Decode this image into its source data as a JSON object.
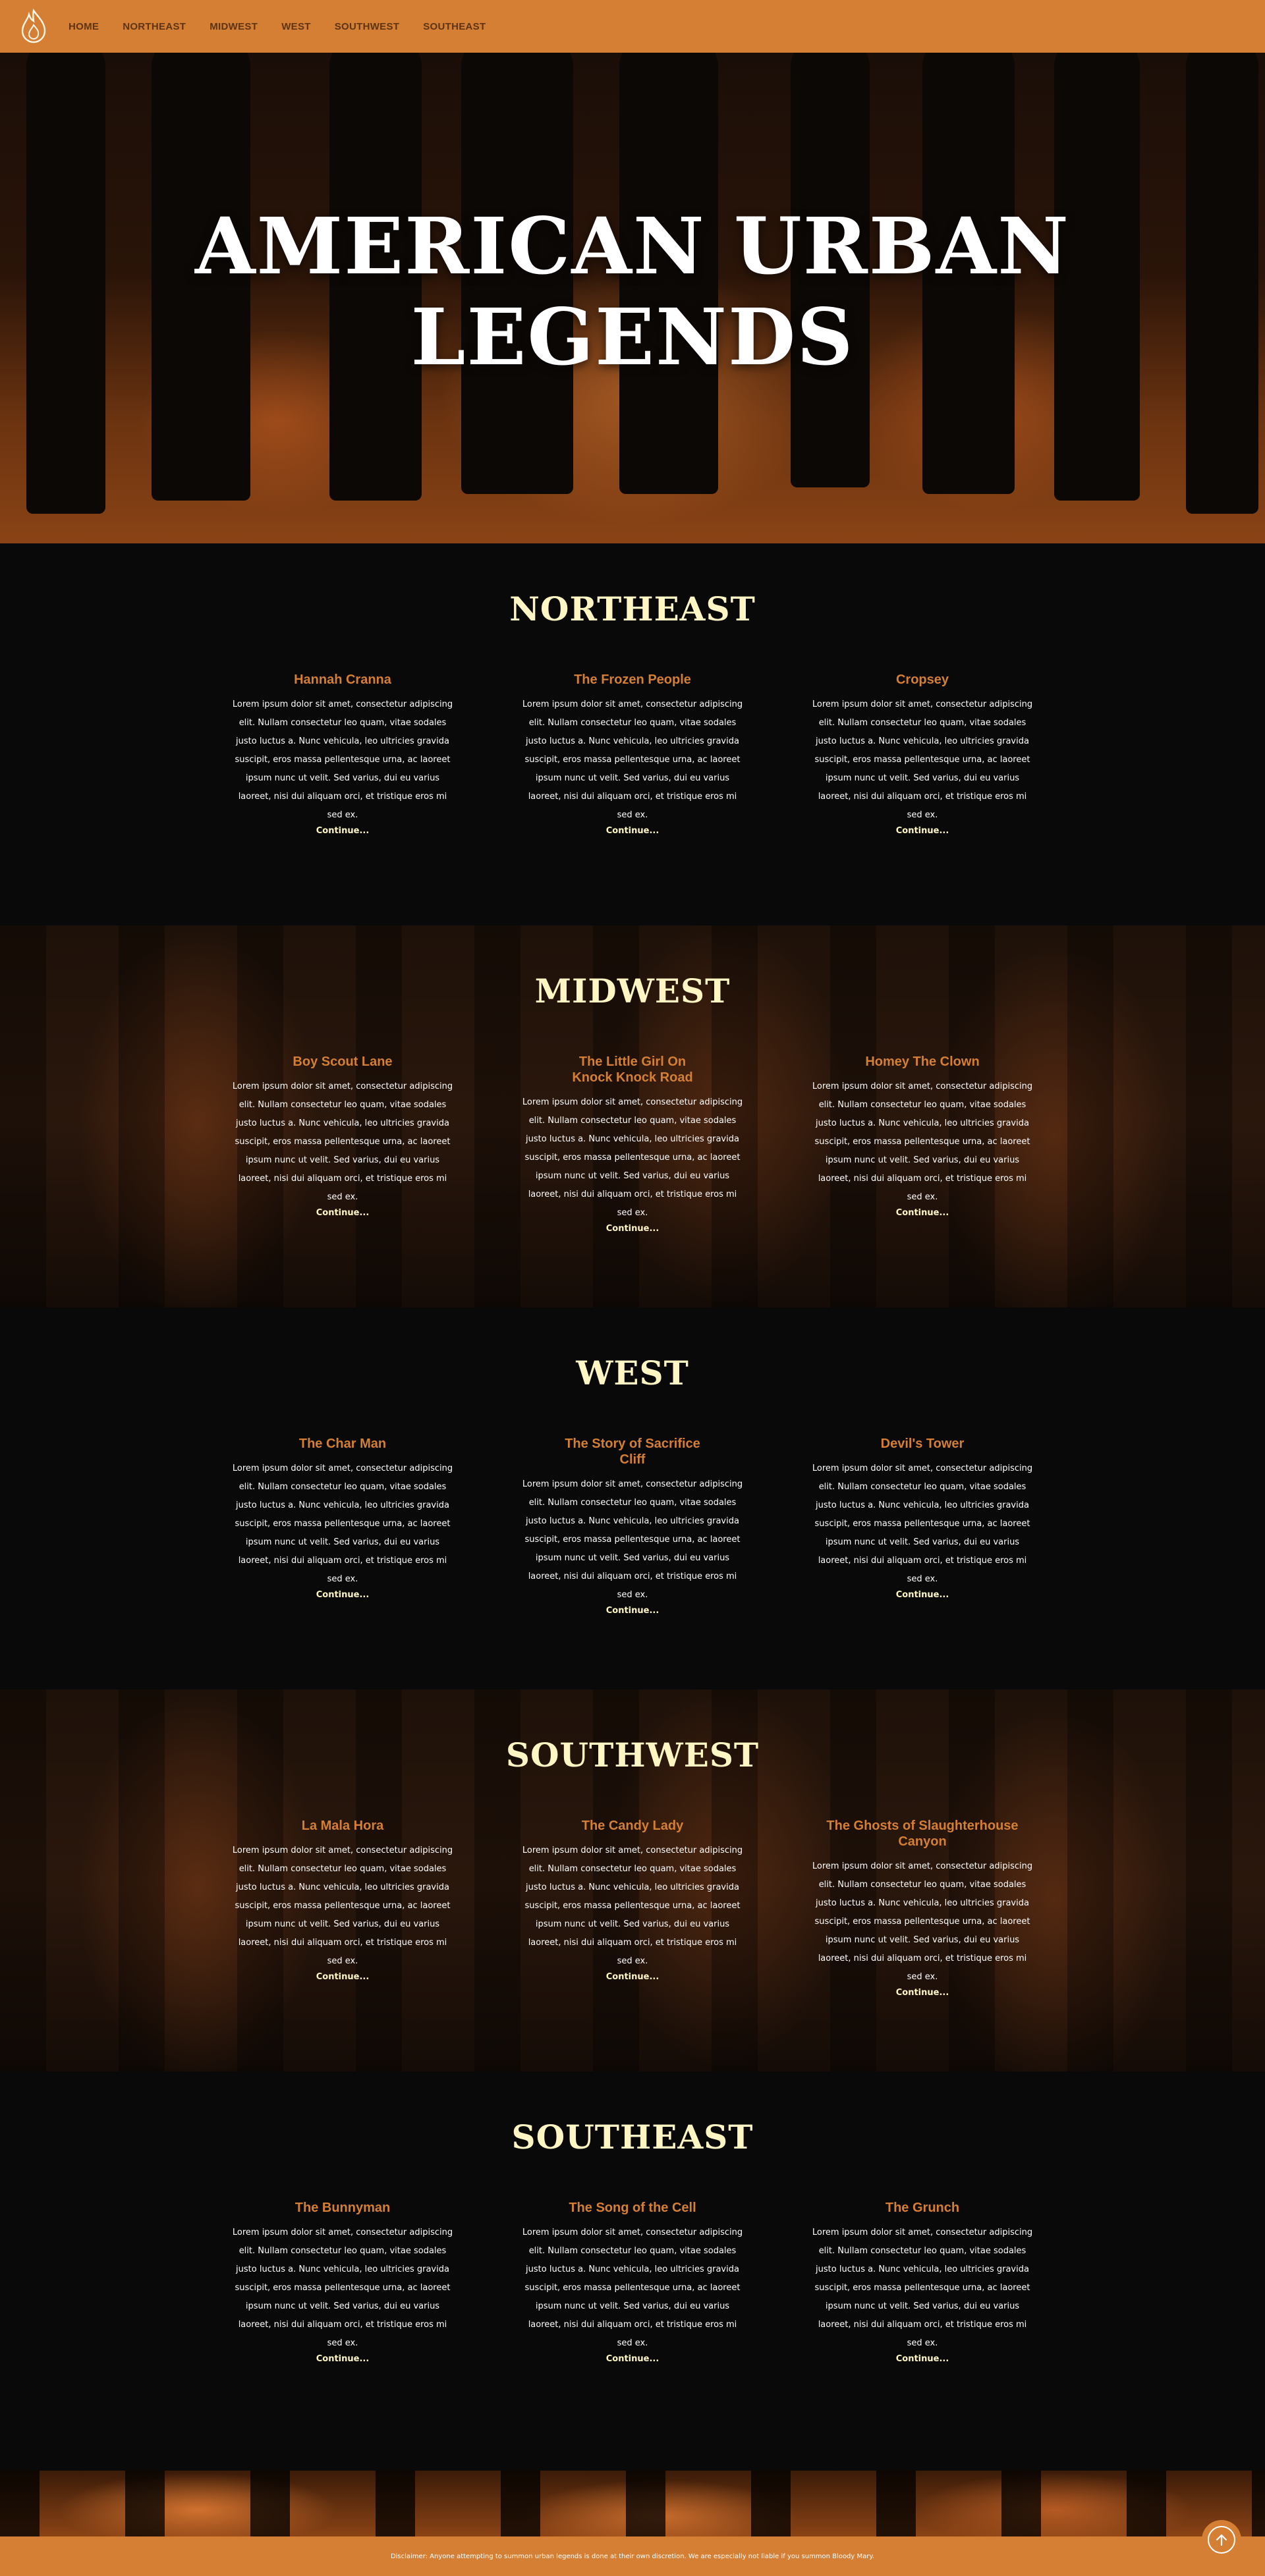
{
  "nav": {
    "links": [
      "HOME",
      "NORTHEAST",
      "MIDWEST",
      "WEST",
      "SOUTHWEST",
      "SOUTHEAST"
    ]
  },
  "hero": {
    "title_line1": "AMERICAN URBAN",
    "title_line2": "LEGENDS"
  },
  "lorem": "Lorem ipsum dolor sit amet, consectetur adipiscing elit. Nullam consectetur leo quam, vitae sodales justo luctus a. Nunc vehicula, leo ultricies gravida suscipit, eros massa pellentesque urna, ac laoreet ipsum nunc ut velit. Sed varius, dui eu varius laoreet, nisi dui aliquam orci, et tristique eros mi sed ex.",
  "continue_label": "Continue...",
  "sections": [
    {
      "title": "NORTHEAST",
      "cards": [
        {
          "title": "Hannah Cranna",
          "body": "Lorem ipsum dolor sit amet, consectetur adipiscing elit. Nullam consectetur leo quam, vitae sodales justo luctus a. Nunc vehicula, leo ultricies gravida suscipit, eros massa pellentesque urna, ac laoreet ipsum nunc ut velit. Sed varius, dui eu varius laoreet, nisi dui aliquam orci, et tristique eros mi sed ex.",
          "more": "Continue..."
        },
        {
          "title": "The Frozen People",
          "body": "Lorem ipsum dolor sit amet, consectetur adipiscing elit. Nullam consectetur leo quam, vitae sodales justo luctus a. Nunc vehicula, leo ultricies gravida suscipit, eros massa pellentesque urna, ac laoreet ipsum nunc ut velit. Sed varius, dui eu varius laoreet, nisi dui aliquam orci, et tristique eros mi sed ex.",
          "more": "Continue..."
        },
        {
          "title": "Cropsey",
          "body": "Lorem ipsum dolor sit amet, consectetur adipiscing elit. Nullam consectetur leo quam, vitae sodales justo luctus a. Nunc vehicula, leo ultricies gravida suscipit, eros massa pellentesque urna, ac laoreet ipsum nunc ut velit. Sed varius, dui eu varius laoreet, nisi dui aliquam orci, et tristique eros mi sed ex.",
          "more": "Continue..."
        }
      ]
    },
    {
      "title": "MIDWEST",
      "cards": [
        {
          "title": "Boy Scout Lane",
          "body": "Lorem ipsum dolor sit amet, consectetur adipiscing elit. Nullam consectetur leo quam, vitae sodales justo luctus a. Nunc vehicula, leo ultricies gravida suscipit, eros massa pellentesque urna, ac laoreet ipsum nunc ut velit. Sed varius, dui eu varius laoreet, nisi dui aliquam orci, et tristique eros mi sed ex.",
          "more": "Continue..."
        },
        {
          "title": "The Little Girl On Knock Knock Road",
          "body": "Lorem ipsum dolor sit amet, consectetur adipiscing elit. Nullam consectetur leo quam, vitae sodales justo luctus a. Nunc vehicula, leo ultricies gravida suscipit, eros massa pellentesque urna, ac laoreet ipsum nunc ut velit. Sed varius, dui eu varius laoreet, nisi dui aliquam orci, et tristique eros mi sed ex.",
          "more": "Continue..."
        },
        {
          "title": "Homey The Clown",
          "body": "Lorem ipsum dolor sit amet, consectetur adipiscing elit. Nullam consectetur leo quam, vitae sodales justo luctus a. Nunc vehicula, leo ultricies gravida suscipit, eros massa pellentesque urna, ac laoreet ipsum nunc ut velit. Sed varius, dui eu varius laoreet, nisi dui aliquam orci, et tristique eros mi sed ex.",
          "more": "Continue..."
        }
      ]
    },
    {
      "title": "WEST",
      "cards": [
        {
          "title": "The Char Man",
          "body": "Lorem ipsum dolor sit amet, consectetur adipiscing elit. Nullam consectetur leo quam, vitae sodales justo luctus a. Nunc vehicula, leo ultricies gravida suscipit, eros massa pellentesque urna, ac laoreet ipsum nunc ut velit. Sed varius, dui eu varius laoreet, nisi dui aliquam orci, et tristique eros mi sed ex.",
          "more": "Continue..."
        },
        {
          "title": "The Story of Sacrifice Cliff",
          "body": "Lorem ipsum dolor sit amet, consectetur adipiscing elit. Nullam consectetur leo quam, vitae sodales justo luctus a. Nunc vehicula, leo ultricies gravida suscipit, eros massa pellentesque urna, ac laoreet ipsum nunc ut velit. Sed varius, dui eu varius laoreet, nisi dui aliquam orci, et tristique eros mi sed ex.",
          "more": "Continue..."
        },
        {
          "title": "Devil's Tower",
          "body": "Lorem ipsum dolor sit amet, consectetur adipiscing elit. Nullam consectetur leo quam, vitae sodales justo luctus a. Nunc vehicula, leo ultricies gravida suscipit, eros massa pellentesque urna, ac laoreet ipsum nunc ut velit. Sed varius, dui eu varius laoreet, nisi dui aliquam orci, et tristique eros mi sed ex.",
          "more": "Continue..."
        }
      ]
    },
    {
      "title": "SOUTHWEST",
      "cards": [
        {
          "title": "La Mala Hora",
          "body": "Lorem ipsum dolor sit amet, consectetur adipiscing elit. Nullam consectetur leo quam, vitae sodales justo luctus a. Nunc vehicula, leo ultricies gravida suscipit, eros massa pellentesque urna, ac laoreet ipsum nunc ut velit. Sed varius, dui eu varius laoreet, nisi dui aliquam orci, et tristique eros mi sed ex.",
          "more": "Continue..."
        },
        {
          "title": "The Candy Lady",
          "body": "Lorem ipsum dolor sit amet, consectetur adipiscing elit. Nullam consectetur leo quam, vitae sodales justo luctus a. Nunc vehicula, leo ultricies gravida suscipit, eros massa pellentesque urna, ac laoreet ipsum nunc ut velit. Sed varius, dui eu varius laoreet, nisi dui aliquam orci, et tristique eros mi sed ex.",
          "more": "Continue..."
        },
        {
          "title": "The Ghosts of Slaughterhouse Canyon",
          "body": "Lorem ipsum dolor sit amet, consectetur adipiscing elit. Nullam consectetur leo quam, vitae sodales justo luctus a. Nunc vehicula, leo ultricies gravida suscipit, eros massa pellentesque urna, ac laoreet ipsum nunc ut velit. Sed varius, dui eu varius laoreet, nisi dui aliquam orci, et tristique eros mi sed ex.",
          "more": "Continue..."
        }
      ]
    },
    {
      "title": "SOUTHEAST",
      "cards": [
        {
          "title": "The Bunnyman",
          "body": "Lorem ipsum dolor sit amet, consectetur adipiscing elit. Nullam consectetur leo quam, vitae sodales justo luctus a. Nunc vehicula, leo ultricies gravida suscipit, eros massa pellentesque urna, ac laoreet ipsum nunc ut velit. Sed varius, dui eu varius laoreet, nisi dui aliquam orci, et tristique eros mi sed ex.",
          "more": "Continue..."
        },
        {
          "title": "The Song of the Cell",
          "body": "Lorem ipsum dolor sit amet, consectetur adipiscing elit. Nullam consectetur leo quam, vitae sodales justo luctus a. Nunc vehicula, leo ultricies gravida suscipit, eros massa pellentesque urna, ac laoreet ipsum nunc ut velit. Sed varius, dui eu varius laoreet, nisi dui aliquam orci, et tristique eros mi sed ex.",
          "more": "Continue..."
        },
        {
          "title": "The Grunch",
          "body": "Lorem ipsum dolor sit amet, consectetur adipiscing elit. Nullam consectetur leo quam, vitae sodales justo luctus a. Nunc vehicula, leo ultricies gravida suscipit, eros massa pellentesque urna, ac laoreet ipsum nunc ut velit. Sed varius, dui eu varius laoreet, nisi dui aliquam orci, et tristique eros mi sed ex.",
          "more": "Continue..."
        }
      ]
    }
  ],
  "footer": {
    "disclaimer": "Disclaimer: Anyone attempting to summon urban legends is done at their own discretion. We are especially not liable if you summon Bloody Mary."
  },
  "icons": {
    "logo": "flame-logo-icon",
    "back_to_top": "arrow-up-icon"
  },
  "colors": {
    "accent": "#d47f33",
    "region_title": "#fff6c4",
    "card_title": "#d47f33",
    "background": "#0a0909"
  }
}
